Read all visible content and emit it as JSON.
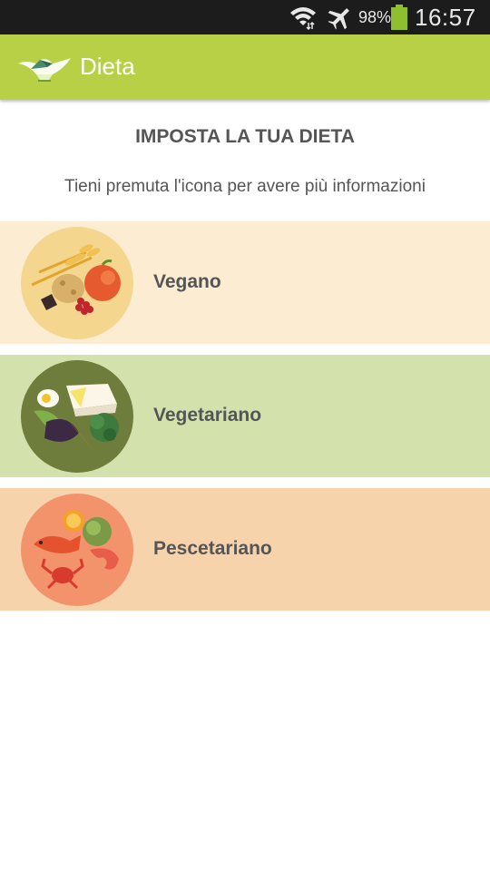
{
  "status_bar": {
    "battery_percent": "98%",
    "time": "16:57",
    "icons": [
      "wifi-icon",
      "airplane-mode-icon",
      "battery-icon"
    ]
  },
  "action_bar": {
    "title": "Dieta",
    "logo_icon": "lamp-logo-icon",
    "color": "#b8d046"
  },
  "main": {
    "heading": "IMPOSTA LA TUA DIETA",
    "subheading": "Tieni premuta l'icona per avere più informazioni",
    "diets": [
      {
        "label": "Vegano",
        "icon": "vegan-food-icon",
        "background": "#fbecd2",
        "circle_color": "#f5d68f"
      },
      {
        "label": "Vegetariano",
        "icon": "vegetarian-food-icon",
        "background": "#d3e2ad",
        "circle_color": "#6e7d3b"
      },
      {
        "label": "Pescetariano",
        "icon": "pescatarian-food-icon",
        "background": "#f6d3aa",
        "circle_color": "#f2936c"
      }
    ]
  }
}
